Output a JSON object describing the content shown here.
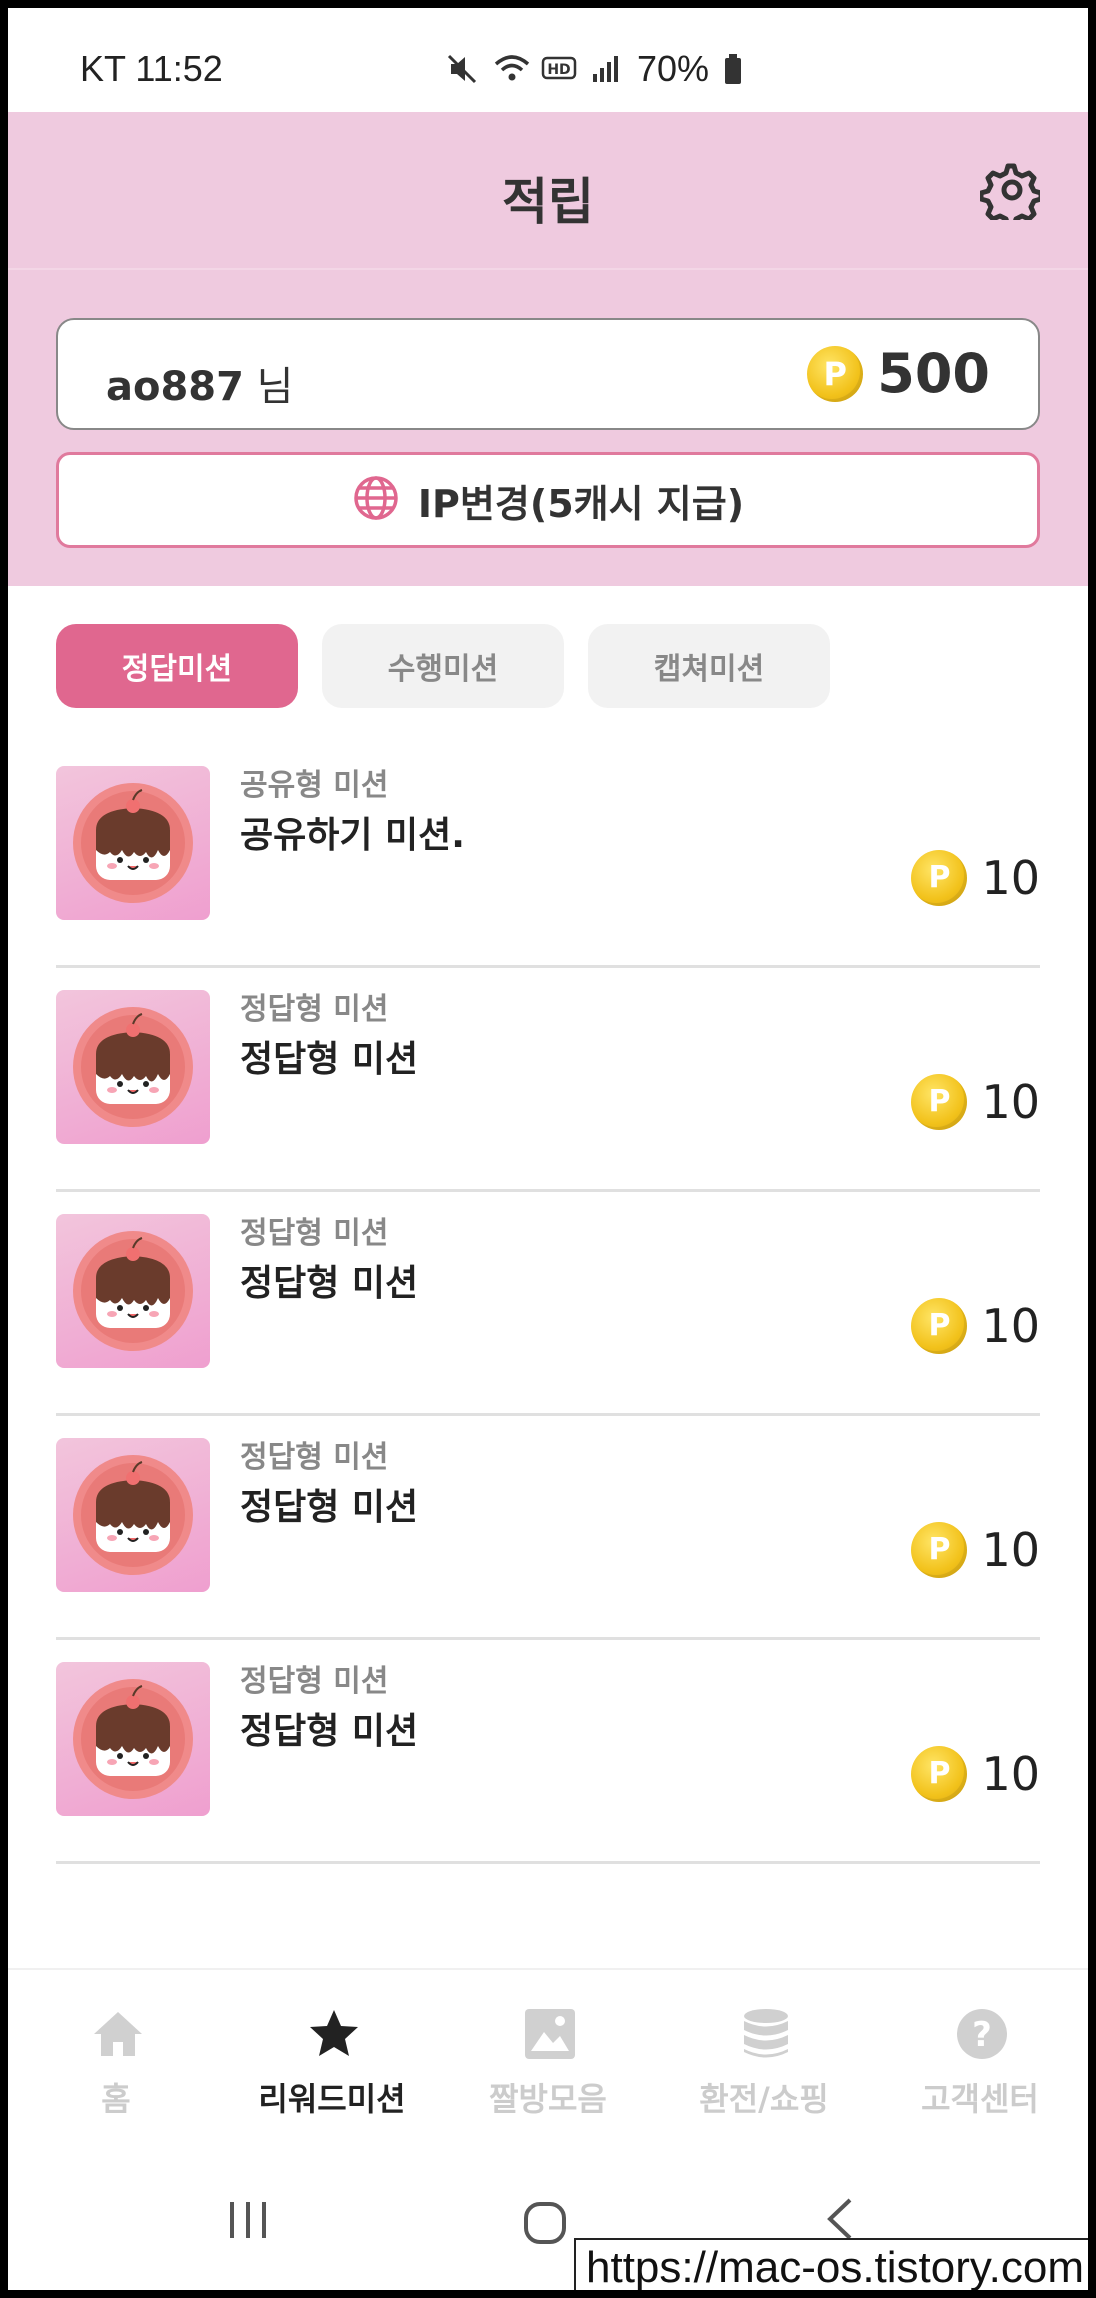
{
  "status_bar": {
    "carrier_time": "KT 11:52",
    "battery": "70%"
  },
  "header": {
    "title": "적립",
    "settings_icon": "gear-icon"
  },
  "user": {
    "name": "ao887",
    "suffix": " 님",
    "points": "500"
  },
  "ip_button": {
    "label": "IP변경(5캐시 지급)",
    "icon": "globe-icon"
  },
  "tabs": [
    {
      "label": "정답미션",
      "active": true
    },
    {
      "label": "수행미션",
      "active": false
    },
    {
      "label": "캡쳐미션",
      "active": false
    }
  ],
  "missions": [
    {
      "category": "공유형 미션",
      "title": "공유하기 미션.",
      "reward": "10"
    },
    {
      "category": "정답형 미션",
      "title": "정답형 미션",
      "reward": "10"
    },
    {
      "category": "정답형 미션",
      "title": "정답형 미션",
      "reward": "10"
    },
    {
      "category": "정답형 미션",
      "title": "정답형 미션",
      "reward": "10"
    },
    {
      "category": "정답형 미션",
      "title": "정답형 미션",
      "reward": "10"
    }
  ],
  "bottom_nav": [
    {
      "label": "홈",
      "icon": "home-icon",
      "active": false
    },
    {
      "label": "리워드미션",
      "icon": "star-icon",
      "active": true
    },
    {
      "label": "짤방모음",
      "icon": "image-icon",
      "active": false
    },
    {
      "label": "환전/쇼핑",
      "icon": "database-icon",
      "active": false
    },
    {
      "label": "고객센터",
      "icon": "help-icon",
      "active": false
    }
  ],
  "watermark": "https://mac-os.tistory.com",
  "colors": {
    "header_bg": "#efcadf",
    "accent": "#e0678f",
    "coin": "#f2c21b"
  }
}
